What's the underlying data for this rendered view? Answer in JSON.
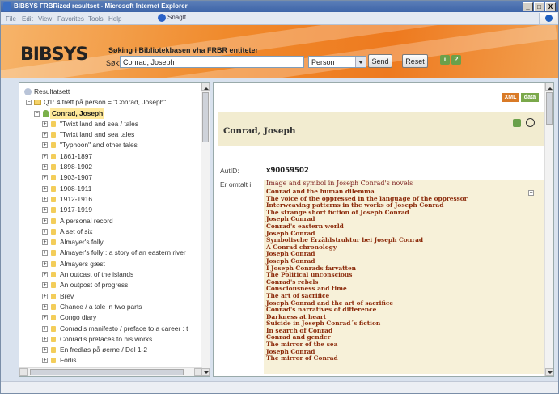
{
  "window": {
    "title": "BIBSYS FRBRized resultset - Microsoft Internet Explorer",
    "controls": [
      "_",
      "□",
      "X"
    ]
  },
  "menubar": {
    "items": [
      "File",
      "Edit",
      "View",
      "Favorites",
      "Tools",
      "Help"
    ],
    "snagit": "SnagIt",
    "snagit_icon": "camera-icon"
  },
  "header": {
    "logo": "BIBSYS",
    "title": "Søking i Bibliotekbasen vha FRBR entiteter",
    "search_label": "Søk:",
    "search_value": "Conrad, Joseph",
    "type_value": "Person",
    "send_label": "Send",
    "reset_label": "Reset",
    "accent": "#f08a2c"
  },
  "tree": {
    "root_label": "Resultatsett",
    "query_label": "Q1: 4 treff på person = \"Conrad, Joseph\"",
    "person_label": "Conrad, Joseph",
    "items": [
      "\"Twixt land and sea / tales",
      "\"Twixt land and sea tales",
      "\"Typhoon\" and other tales",
      "1861-1897",
      "1898-1902",
      "1903-1907",
      "1908-1911",
      "1912-1916",
      "1917-1919",
      "A personal record",
      "A set of six",
      "Almayer's folly",
      "Almayer's folly : a story of an eastern river",
      "Almayers gæst",
      "An outcast of the islands",
      "An outpost of progress",
      "Brev",
      "Chance / a tale in two parts",
      "Congo diary",
      "Conrad's manifesto / preface to a career : t",
      "Conrad's prefaces to his works",
      "En fredløs på øerne / Del 1-2",
      "Forlis"
    ]
  },
  "record": {
    "xml_label": "XML",
    "data_label": "data",
    "name": "Conrad, Joseph",
    "autid_label": "AutID:",
    "autid_value": "x90059502",
    "omtalt_label": "Er omtalt i",
    "first_item": "Image and symbol in Joseph Conrad's novels",
    "items": [
      "Conrad and the human dilemma",
      "The voice of the oppressed in the language of the oppressor",
      "Interweaving patterns in the works of Joseph Conrad",
      "The strange short fiction of Joseph Conrad",
      "Joseph Conrad",
      "Conrad's eastern world",
      "Joseph Conrad",
      "Symbolische Erzählstruktur bei Joseph Conrad",
      "A Conrad chronology",
      "Joseph Conrad",
      "Joseph Conrad",
      "I Joseph Conrads farvatten",
      "The Political unconscious",
      "Conrad's rebels",
      "Consciousness and time",
      "The art of sacrifice",
      "Joseph Conrad and the art of sacrifice",
      "Conrad's narratives of difference",
      "Darkness at heart",
      "Suicide in Joseph Conrad´s fiction",
      "In search of Conrad",
      "Conrad and gender",
      "The mirror of the sea",
      "Joseph Conrad",
      "The mirror of Conrad"
    ]
  }
}
